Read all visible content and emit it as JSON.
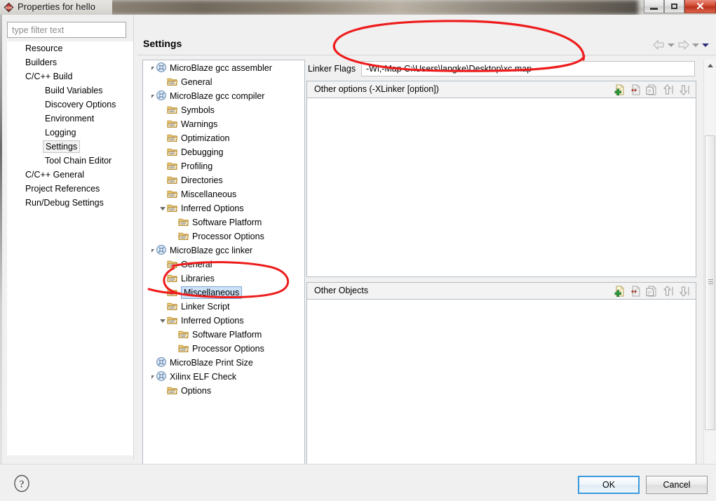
{
  "window": {
    "title": "Properties for hello",
    "icon": "sdk-icon",
    "controls": {
      "minimize": "minimize",
      "maximize": "maximize",
      "close": "close"
    }
  },
  "filter": {
    "placeholder": "type filter text",
    "value": ""
  },
  "sidebar": {
    "items": [
      {
        "label": "Resource",
        "indent": 0,
        "selected": false
      },
      {
        "label": "Builders",
        "indent": 0,
        "selected": false
      },
      {
        "label": "C/C++ Build",
        "indent": 0,
        "selected": false
      },
      {
        "label": "Build Variables",
        "indent": 1,
        "selected": false
      },
      {
        "label": "Discovery Options",
        "indent": 1,
        "selected": false
      },
      {
        "label": "Environment",
        "indent": 1,
        "selected": false
      },
      {
        "label": "Logging",
        "indent": 1,
        "selected": false
      },
      {
        "label": "Settings",
        "indent": 1,
        "selected": true
      },
      {
        "label": "Tool Chain Editor",
        "indent": 1,
        "selected": false
      },
      {
        "label": "C/C++ General",
        "indent": 0,
        "selected": false
      },
      {
        "label": "Project References",
        "indent": 0,
        "selected": false
      },
      {
        "label": "Run/Debug Settings",
        "indent": 0,
        "selected": false
      }
    ]
  },
  "page": {
    "title": "Settings",
    "nav": {
      "back": "back-arrow",
      "back_menu": "back-dropdown",
      "forward": "forward-arrow",
      "forward_menu": "forward-dropdown",
      "view_menu": "view-menu-dropdown"
    }
  },
  "settings_tree": [
    {
      "label": "MicroBlaze gcc assembler",
      "indent": 0,
      "icon": "tool-icon",
      "twisty": "open",
      "selected": false
    },
    {
      "label": "General",
      "indent": 1,
      "icon": "folder-icon",
      "twisty": "none",
      "selected": false
    },
    {
      "label": "MicroBlaze gcc compiler",
      "indent": 0,
      "icon": "tool-icon",
      "twisty": "open",
      "selected": false
    },
    {
      "label": "Symbols",
      "indent": 1,
      "icon": "folder-icon",
      "twisty": "none",
      "selected": false
    },
    {
      "label": "Warnings",
      "indent": 1,
      "icon": "folder-icon",
      "twisty": "none",
      "selected": false
    },
    {
      "label": "Optimization",
      "indent": 1,
      "icon": "folder-icon",
      "twisty": "none",
      "selected": false
    },
    {
      "label": "Debugging",
      "indent": 1,
      "icon": "folder-icon",
      "twisty": "none",
      "selected": false
    },
    {
      "label": "Profiling",
      "indent": 1,
      "icon": "folder-icon",
      "twisty": "none",
      "selected": false
    },
    {
      "label": "Directories",
      "indent": 1,
      "icon": "folder-icon",
      "twisty": "none",
      "selected": false
    },
    {
      "label": "Miscellaneous",
      "indent": 1,
      "icon": "folder-icon",
      "twisty": "none",
      "selected": false
    },
    {
      "label": "Inferred Options",
      "indent": 1,
      "icon": "folder-icon",
      "twisty": "open",
      "selected": false
    },
    {
      "label": "Software Platform",
      "indent": 2,
      "icon": "folder-icon",
      "twisty": "none",
      "selected": false
    },
    {
      "label": "Processor Options",
      "indent": 2,
      "icon": "folder-icon",
      "twisty": "none",
      "selected": false
    },
    {
      "label": "MicroBlaze gcc linker",
      "indent": 0,
      "icon": "tool-icon",
      "twisty": "open",
      "selected": false
    },
    {
      "label": "General",
      "indent": 1,
      "icon": "folder-icon",
      "twisty": "none",
      "selected": false
    },
    {
      "label": "Libraries",
      "indent": 1,
      "icon": "folder-icon",
      "twisty": "none",
      "selected": false
    },
    {
      "label": "Miscellaneous",
      "indent": 1,
      "icon": "folder-icon",
      "twisty": "none",
      "selected": true
    },
    {
      "label": "Linker Script",
      "indent": 1,
      "icon": "folder-icon",
      "twisty": "none",
      "selected": false
    },
    {
      "label": "Inferred Options",
      "indent": 1,
      "icon": "folder-icon",
      "twisty": "open",
      "selected": false
    },
    {
      "label": "Software Platform",
      "indent": 2,
      "icon": "folder-icon",
      "twisty": "none",
      "selected": false
    },
    {
      "label": "Processor Options",
      "indent": 2,
      "icon": "folder-icon",
      "twisty": "none",
      "selected": false
    },
    {
      "label": "MicroBlaze Print Size",
      "indent": 0,
      "icon": "tool-icon",
      "twisty": "none",
      "selected": false
    },
    {
      "label": "Xilinx ELF Check",
      "indent": 0,
      "icon": "tool-icon",
      "twisty": "open",
      "selected": false
    },
    {
      "label": "Options",
      "indent": 1,
      "icon": "folder-icon",
      "twisty": "none",
      "selected": false
    }
  ],
  "main": {
    "linker_flags": {
      "label": "Linker Flags",
      "value": "-Wl,-Map C:\\Users\\langke\\Desktop\\xc.map",
      "placeholder": ""
    },
    "other_options": {
      "title": "Other options (-XLinker [option])",
      "items": [],
      "tools": [
        "add-icon",
        "delete-icon",
        "edit-icon",
        "move-up-icon",
        "move-down-icon"
      ]
    },
    "other_objects": {
      "title": "Other Objects",
      "items": [],
      "tools": [
        "add-icon",
        "delete-icon",
        "edit-icon",
        "move-up-icon",
        "move-down-icon"
      ]
    }
  },
  "footer": {
    "help": "help-icon",
    "ok_label": "OK",
    "cancel_label": "Cancel"
  },
  "annotations": [
    {
      "name": "red-ellipse-linker-flags",
      "color": "#ee1c1c"
    },
    {
      "name": "red-ellipse-miscellaneous",
      "color": "#ee1c1c"
    }
  ],
  "colors": {
    "accent": "#3b9ade",
    "annotation": "#ee1c1c",
    "selection": "#cde2f7",
    "chrome": "#f0f0f0"
  }
}
